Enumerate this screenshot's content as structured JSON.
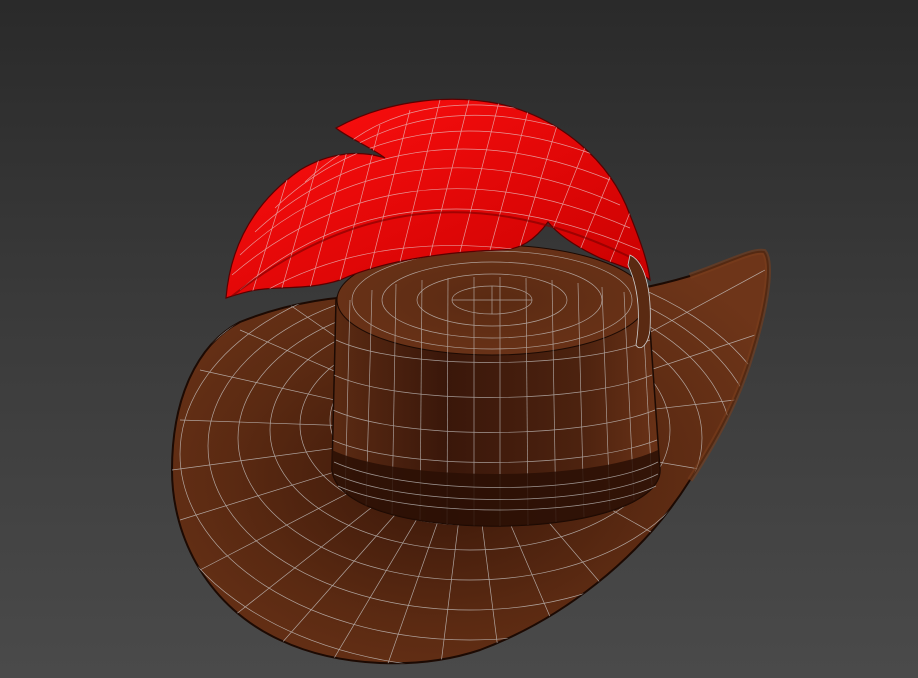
{
  "viewport": {
    "background_top": "#2a2a2a",
    "background_bottom": "#4a4a4a"
  },
  "model": {
    "hat_color": "#5a2a12",
    "hat_shadow_color": "#2e1207",
    "feather_color": "#e00000",
    "wire_color": "#d8d8d8"
  }
}
